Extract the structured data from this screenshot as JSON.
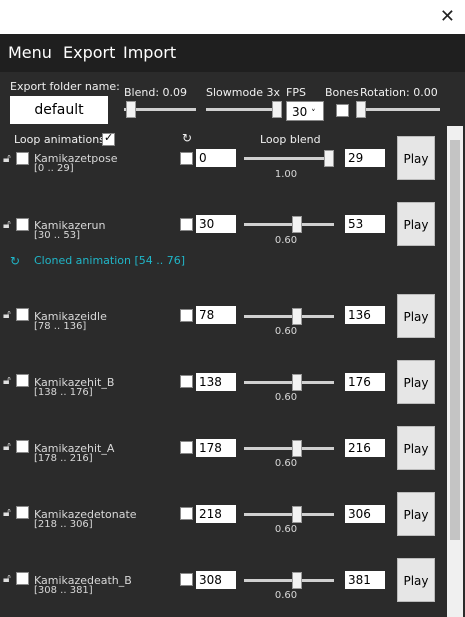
{
  "window": {
    "close_glyph": "✕"
  },
  "menu": {
    "items": [
      "Menu",
      "Export",
      "Import"
    ]
  },
  "controls": {
    "export_folder_label": "Export folder name:",
    "export_folder_value": "default",
    "blend_label": "Blend: 0.09",
    "slowmode_label": "Slowmode 3x",
    "fps_label": "FPS",
    "fps_value": "30",
    "bones_label": "Bones",
    "rotation_label": "Rotation: 0.00",
    "loop_animations_label": "Loop animations:",
    "loop_blend_label": "Loop blend"
  },
  "cloned": "Cloned animation [54 .. 76]",
  "animations": [
    {
      "name": "Kamikazetpose",
      "range": "[0 .. 29]",
      "start": "0",
      "end": "29",
      "blend": "1.00",
      "blend_level": 1.0,
      "play": "Play"
    },
    {
      "name": "Kamikazerun",
      "range": "[30 .. 53]",
      "start": "30",
      "end": "53",
      "blend": "0.60",
      "blend_level": 0.6,
      "play": "Play"
    },
    {
      "name": "Kamikazeidle",
      "range": "[78 .. 136]",
      "start": "78",
      "end": "136",
      "blend": "0.60",
      "blend_level": 0.6,
      "play": "Play"
    },
    {
      "name": "Kamikazehit_B",
      "range": "[138 .. 176]",
      "start": "138",
      "end": "176",
      "blend": "0.60",
      "blend_level": 0.6,
      "play": "Play"
    },
    {
      "name": "Kamikazehit_A",
      "range": "[178 .. 216]",
      "start": "178",
      "end": "216",
      "blend": "0.60",
      "blend_level": 0.6,
      "play": "Play"
    },
    {
      "name": "Kamikazedetonate",
      "range": "[218 .. 306]",
      "start": "218",
      "end": "306",
      "blend": "0.60",
      "blend_level": 0.6,
      "play": "Play"
    },
    {
      "name": "Kamikazedeath_B",
      "range": "[308 .. 381]",
      "start": "308",
      "end": "381",
      "blend": "0.60",
      "blend_level": 0.6,
      "play": "Play"
    }
  ],
  "icons": {
    "lock": "lock-icon",
    "loop": "loop-icon",
    "clone": "clone-icon"
  },
  "colors": {
    "accent": "#20b6c8",
    "background": "#2b2b2b",
    "menubar": "#1f1f1f"
  }
}
